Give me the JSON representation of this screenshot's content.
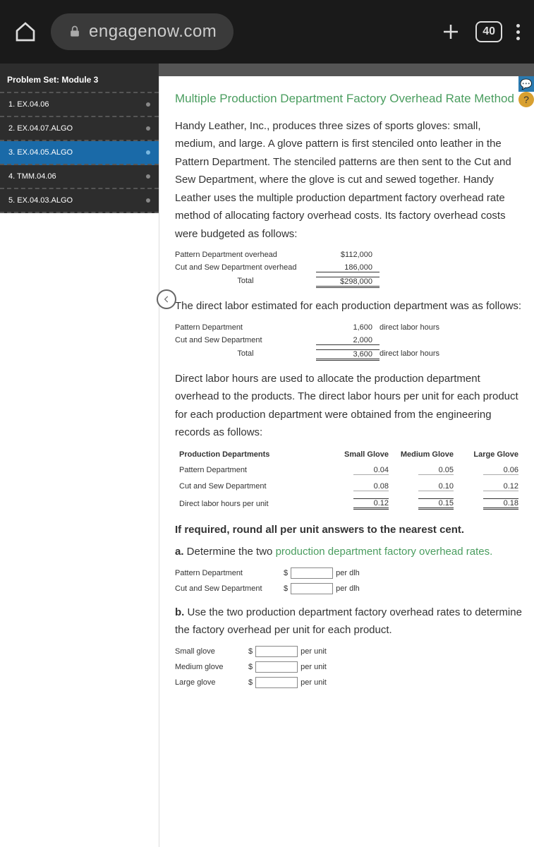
{
  "browser": {
    "url": "engagenow.com",
    "tab_count": "40"
  },
  "sidebar": {
    "header": "Problem Set: Module 3",
    "items": [
      {
        "label": "1. EX.04.06"
      },
      {
        "label": "2. EX.04.07.ALGO"
      },
      {
        "label": "3. EX.04.05.ALGO"
      },
      {
        "label": "4. TMM.04.06"
      },
      {
        "label": "5. EX.04.03.ALGO"
      }
    ]
  },
  "content": {
    "title": "Multiple Production Department Factory Overhead Rate Method",
    "intro": "Handy Leather, Inc., produces three sizes of sports gloves: small, medium, and large. A glove pattern is first stenciled onto leather in the Pattern Department. The stenciled patterns are then sent to the Cut and Sew Department, where the glove is cut and sewed together. Handy Leather uses the multiple production department factory overhead rate method of allocating factory overhead costs. Its factory overhead costs were budgeted as follows:",
    "overhead": {
      "rows": [
        {
          "label": "Pattern Department overhead",
          "value": "$112,000"
        },
        {
          "label": "Cut and Sew Department overhead",
          "value": "186,000"
        }
      ],
      "total_label": "Total",
      "total_value": "$298,000"
    },
    "p2": "The direct labor estimated for each production department was as follows:",
    "labor": {
      "rows": [
        {
          "label": "Pattern Department",
          "value": "1,600",
          "unit": "direct labor hours"
        },
        {
          "label": "Cut and Sew Department",
          "value": "2,000",
          "unit": ""
        }
      ],
      "total_label": "Total",
      "total_value": "3,600",
      "total_unit": "direct labor hours"
    },
    "p3": "Direct labor hours are used to allocate the production department overhead to the products. The direct labor hours per unit for each product for each production department were obtained from the engineering records as follows:",
    "dlh_table": {
      "headers": [
        "Production Departments",
        "Small Glove",
        "Medium Glove",
        "Large Glove"
      ],
      "rows": [
        {
          "label": "Pattern Department",
          "v": [
            "0.04",
            "0.05",
            "0.06"
          ]
        },
        {
          "label": "Cut and Sew Department",
          "v": [
            "0.08",
            "0.10",
            "0.12"
          ]
        },
        {
          "label": "Direct labor hours per unit",
          "v": [
            "0.12",
            "0.15",
            "0.18"
          ]
        }
      ]
    },
    "round_note": "If required, round all per unit answers to the nearest cent.",
    "qa_prefix": "a.",
    "qa_text": "  Determine the two ",
    "qa_link": "production department factory overhead rates.",
    "qa_inputs": [
      {
        "label": "Pattern Department",
        "suffix": "per dlh"
      },
      {
        "label": "Cut and Sew Department",
        "suffix": "per dlh"
      }
    ],
    "qb_prefix": "b.",
    "qb_text": "  Use the two production department factory overhead rates to determine the factory overhead per unit for each product.",
    "qb_inputs": [
      {
        "label": "Small glove",
        "suffix": "per unit"
      },
      {
        "label": "Medium glove",
        "suffix": "per unit"
      },
      {
        "label": "Large glove",
        "suffix": "per unit"
      }
    ]
  }
}
